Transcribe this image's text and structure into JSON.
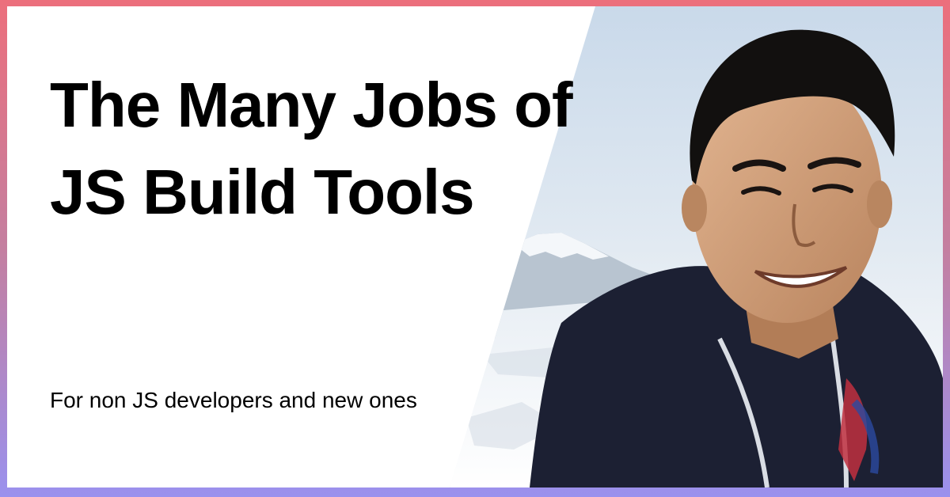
{
  "card": {
    "title": "The Many Jobs of JS Build Tools",
    "subtitle": "For non JS developers and new ones"
  },
  "colors": {
    "border_top": "#ec6f7c",
    "border_bottom": "#9a91ee",
    "background": "#ffffff",
    "text": "#000000"
  }
}
